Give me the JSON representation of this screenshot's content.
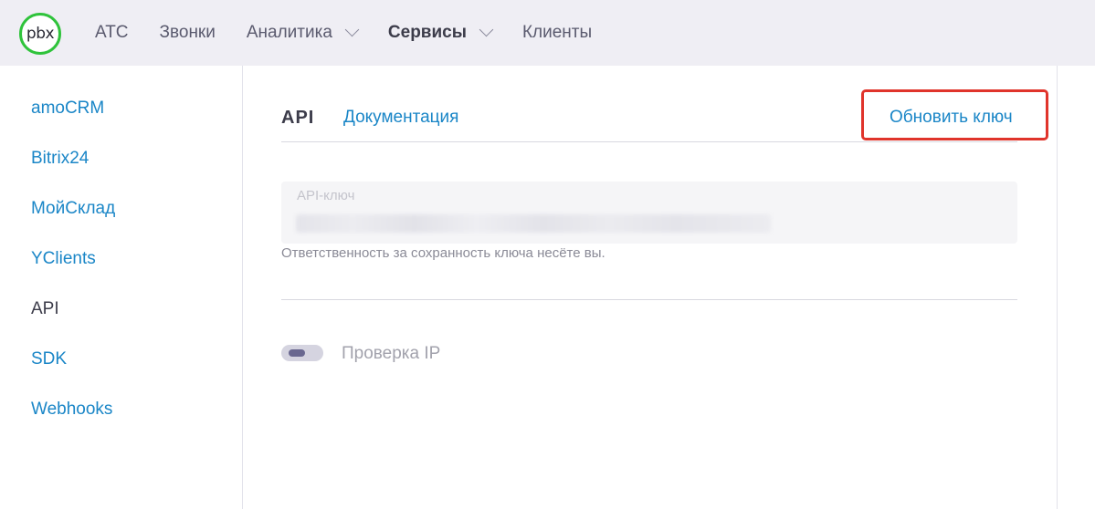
{
  "header": {
    "logo_text": "pbx",
    "nav": [
      {
        "label": "АТС",
        "has_dropdown": false,
        "active": false
      },
      {
        "label": "Звонки",
        "has_dropdown": false,
        "active": false
      },
      {
        "label": "Аналитика",
        "has_dropdown": true,
        "active": false
      },
      {
        "label": "Сервисы",
        "has_dropdown": true,
        "active": true
      },
      {
        "label": "Клиенты",
        "has_dropdown": false,
        "active": false
      }
    ]
  },
  "sidebar": {
    "items": [
      {
        "label": "amoCRM",
        "active": false
      },
      {
        "label": "Bitrix24",
        "active": false
      },
      {
        "label": "МойСклад",
        "active": false
      },
      {
        "label": "YClients",
        "active": false
      },
      {
        "label": "API",
        "active": true
      },
      {
        "label": "SDK",
        "active": false
      },
      {
        "label": "Webhooks",
        "active": false
      }
    ]
  },
  "main": {
    "title": "API",
    "doc_link": "Документация",
    "refresh_key": "Обновить ключ",
    "api_key": {
      "label": "API-ключ",
      "value_hidden": true
    },
    "hint": "Ответственность за сохранность ключа несёте вы.",
    "ip_check": {
      "label": "Проверка IP",
      "enabled": false
    }
  },
  "colors": {
    "link": "#1a86c7",
    "logo_ring": "#2fc33b",
    "highlight": "#e0342b",
    "header_bg": "#efeef4"
  }
}
